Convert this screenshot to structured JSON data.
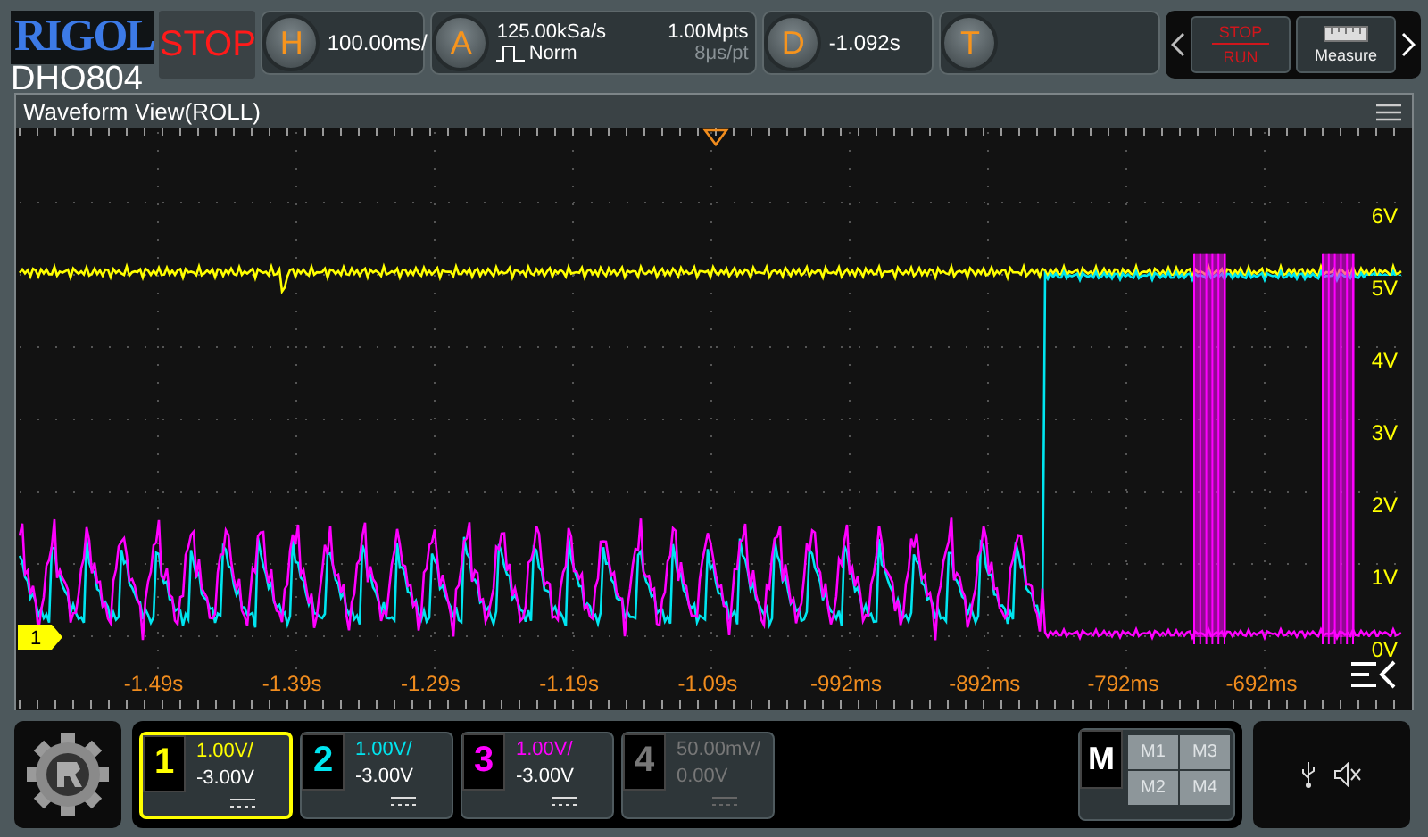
{
  "header": {
    "logo": "RIGOL",
    "model": "DHO804",
    "run_state": "STOP",
    "horizontal": {
      "letter": "H",
      "scale": "100.00ms/"
    },
    "acquire": {
      "letter": "A",
      "sample_rate": "125.00kSa/s",
      "memory_depth": "1.00Mpts",
      "mode": "Norm",
      "time_per_point": "8μs/pt"
    },
    "delay": {
      "letter": "D",
      "value": "-1.092s"
    },
    "trigger": {
      "letter": "T"
    },
    "quick_buttons": [
      {
        "kind": "stop_run",
        "top": "STOP",
        "bottom": "RUN"
      },
      {
        "kind": "measure",
        "label": "Measure"
      }
    ]
  },
  "waveform_view": {
    "title": "Waveform View(ROLL)",
    "channel_marker": "1",
    "y_labels": [
      "6V",
      "5V",
      "4V",
      "3V",
      "2V",
      "1V",
      "0V"
    ],
    "x_labels": [
      "-1.49s",
      "-1.39s",
      "-1.29s",
      "-1.19s",
      "-1.09s",
      "-992ms",
      "-892ms",
      "-792ms",
      "-692ms"
    ]
  },
  "channels": [
    {
      "number": "1",
      "scale": "1.00V/",
      "offset": "-3.00V",
      "color": "#ffff00",
      "selected": true,
      "enabled": true
    },
    {
      "number": "2",
      "scale": "1.00V/",
      "offset": "-3.00V",
      "color": "#00e5f0",
      "selected": false,
      "enabled": true
    },
    {
      "number": "3",
      "scale": "1.00V/",
      "offset": "-3.00V",
      "color": "#ff00ff",
      "selected": false,
      "enabled": true
    },
    {
      "number": "4",
      "scale": "50.00mV/",
      "offset": "0.00V",
      "selected": false,
      "enabled": false
    }
  ],
  "math": {
    "label": "M",
    "buttons": [
      "M1",
      "M3",
      "M2",
      "M4"
    ]
  }
}
